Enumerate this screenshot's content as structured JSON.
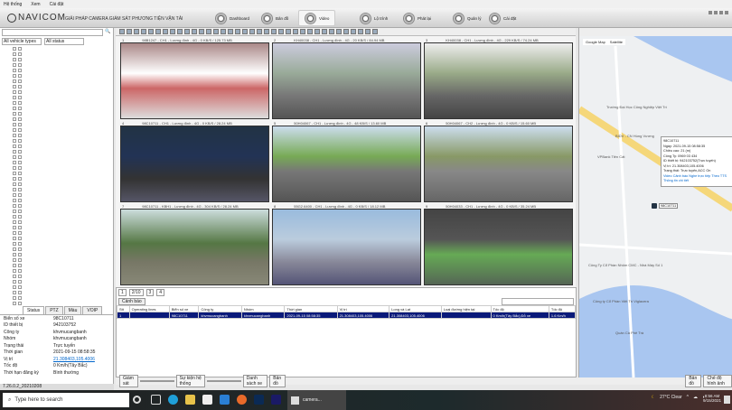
{
  "menu": [
    "Hệ thống",
    "Xem",
    "Cài đặt"
  ],
  "header": {
    "brand": "NAVICOM",
    "slogan": "GIẢI PHÁP CAMERA GIÁM SÁT PHƯƠNG TIỆN VẬN TẢI",
    "nav": [
      {
        "label": "Dashboard",
        "active": false
      },
      {
        "label": "Bản đồ",
        "active": false
      },
      {
        "label": "Video",
        "active": true
      },
      {
        "label": "Lộ trình",
        "active": false
      },
      {
        "label": "Phát lại",
        "active": false
      },
      {
        "label": "Quản lý",
        "active": false
      },
      {
        "label": "Cài đặt",
        "active": false
      }
    ]
  },
  "left": {
    "search_value": "",
    "filter_type": "All vehicle types",
    "filter_status": "All status",
    "info_tabs": [
      "Status",
      "PTZ",
      "Màu",
      "VOIP"
    ],
    "info": [
      {
        "k": "Biển số xe",
        "v": "98C10711"
      },
      {
        "k": "ID thiết bị",
        "v": "942103752"
      },
      {
        "k": "Công ty",
        "v": "khvmucangbanh"
      },
      {
        "k": "Nhóm",
        "v": "khvmucangbanh"
      },
      {
        "k": "Trạng thái",
        "v": "Trực tuyến"
      },
      {
        "k": "Thời gian",
        "v": "2021-09-15 08:58:35"
      },
      {
        "k": "Vị trí",
        "v": "21.308403,105.4006"
      },
      {
        "k": "Tốc độ",
        "v": "0 Km/h(Tây Bắc)"
      },
      {
        "k": "Thời hạn đăng ký",
        "v": "Bình thường"
      }
    ],
    "version": "7.26.0.2_20210208"
  },
  "videos": [
    {
      "n": "1",
      "cap": "98B1247 - CH1 - Lương đình - 4G - 0 KB/S / 125.73 MB"
    },
    {
      "n": "2",
      "cap": "KH40038 - CH1 - Lương đình - 4G - 20 KB/S / 84.94 MB"
    },
    {
      "n": "3",
      "cap": "KH40038 - CH1 - Lương đình - 4G - 229 KB/S / 74.24 MB"
    },
    {
      "n": "4",
      "cap": "98C10711 - CH1 - Lương đình - 4G - 0 KB/S / 28.24 MB"
    },
    {
      "n": "5",
      "cap": "50H04067 - CH1 - Lương đình - 4G - 48 KB/S / 13.60 MB"
    },
    {
      "n": "6",
      "cap": "50H04067 - CH2 - Lương đình - 4G - 0 KB/S / 15.60 MB"
    },
    {
      "n": "7",
      "cap": "98C10711 - KBH1 - Lương đình - 4G - 304 KB/S / 28.24 MB"
    },
    {
      "n": "8",
      "cap": "55G2.6400 - CH1 - Lương đình - 4G - 0 KB/S / 18.12 MB"
    },
    {
      "n": "9",
      "cap": "50H04033 - CH1 - Lương đình - 4G - 0 KB/S / 35.24 MB"
    }
  ],
  "page_tabs": [
    "1",
    "2/10",
    "3",
    "4"
  ],
  "alarm_label": "Cảnh báo",
  "table": {
    "headers": [
      "Stt",
      "Operating lines",
      "Biển số xe",
      "Công ty",
      "Nhóm",
      "Thời gian",
      "Vị trí",
      "Long và Lat",
      "Loại đường hiện tại",
      "Tốc độ",
      "Tốc độ"
    ],
    "rows": [
      [
        "1",
        "",
        "98C10711",
        "khvmucangbanh",
        "khvmucangbanh",
        "2021-09-15 08:58:35",
        "21.308403,105.4006",
        "21.308403,105.4006",
        "",
        "0 Km/h(Tây Bắc),Đỗ xe",
        "1.6 Km/h"
      ]
    ]
  },
  "bottom_tabs": [
    "Giám sát",
    "",
    "Sự kiện hệ thống",
    "",
    "Danh sách xe",
    "Bản đồ",
    "Bản đồ",
    "Chế độ hình ảnh"
  ],
  "map": {
    "tabs": [
      "Google Map",
      "Satellite"
    ],
    "marker_label": "98C10711",
    "popup": [
      "98C10711",
      "Ngày: 2021-09-15 08:58:35",
      "Chiều cao: 21 (m)",
      "Công Ty: 0969 03 434",
      "ID thiết bị: 942103752(Trực tuyến)",
      "Vị trí: 21.308403,105.4006",
      "Trạng thái: Trực tuyến,ACC On",
      "Video Cảnh báo Nghe trực tiếp Theo TTS Thông tin chi tiết"
    ],
    "places": [
      "Trường Đại Học Công Nghiệp Việt Trì",
      "BIDV - CN Hùng Vương",
      "VPBank Tiên Cát",
      "Công Ty Cổ Phần Nhôm CMC - Nhà Máy Số 1",
      "Công ty Cổ Phần Việt Trì Viglacera",
      "Quán Cà Phê Trà"
    ]
  },
  "taskbar": {
    "search_placeholder": "Type here to search",
    "app_label": "camera...",
    "weather": "27°C Clear",
    "time": "8:56 AM",
    "date": "9/15/2021"
  }
}
